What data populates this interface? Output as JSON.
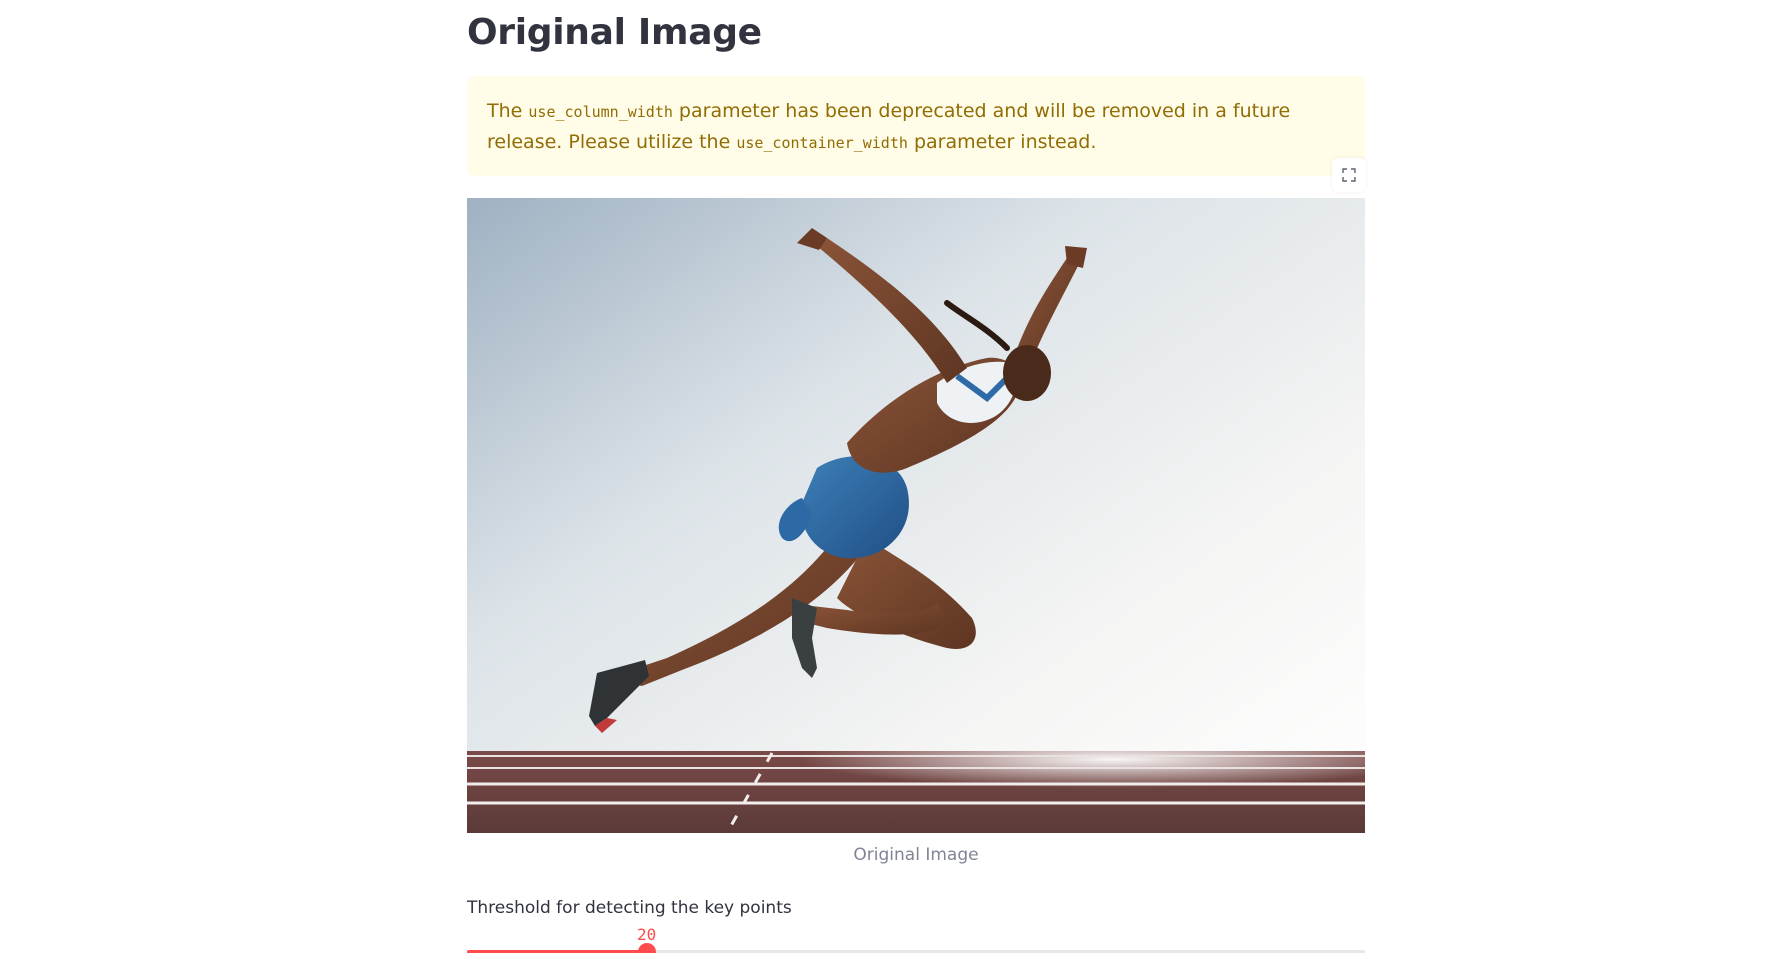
{
  "header": {
    "title": "Original Image"
  },
  "warning": {
    "text_1": "The ",
    "code_1": "use_column_width",
    "text_2": " parameter has been deprecated and will be removed in a future release. Please utilize the ",
    "code_2": "use_container_width",
    "text_3": " parameter instead."
  },
  "image": {
    "alt": "Sprinter athlete in blue outfit leaping forward on a running track",
    "caption": "Original Image",
    "fullscreen_icon": "fullscreen-icon"
  },
  "slider": {
    "label": "Threshold for detecting the key points",
    "value": "20",
    "value_fraction": 0.2,
    "accent_color": "#ff4b4b"
  },
  "colors": {
    "warning_bg": "#fffce7",
    "warning_text": "#926c05",
    "accent": "#ff4b4b"
  }
}
